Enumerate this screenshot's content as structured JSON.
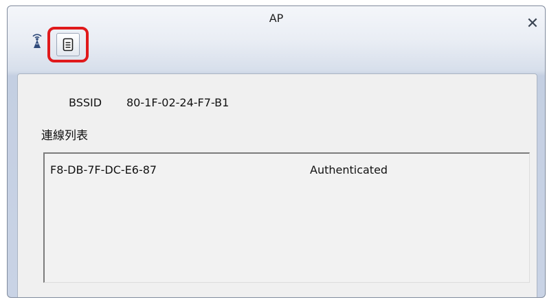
{
  "window": {
    "title": "AP",
    "close_symbol": "✕"
  },
  "tabs": [
    {
      "icon": "ap-signal-icon"
    },
    {
      "icon": "list-document-icon",
      "highlighted": true
    }
  ],
  "highlight_color": "#e0191b",
  "info": {
    "bssid_label": "BSSID",
    "bssid_value": "80-1F-02-24-F7-B1"
  },
  "connection_list": {
    "title": "連線列表",
    "rows": [
      {
        "mac": "F8-DB-7F-DC-E6-87",
        "status": "Authenticated"
      }
    ]
  }
}
